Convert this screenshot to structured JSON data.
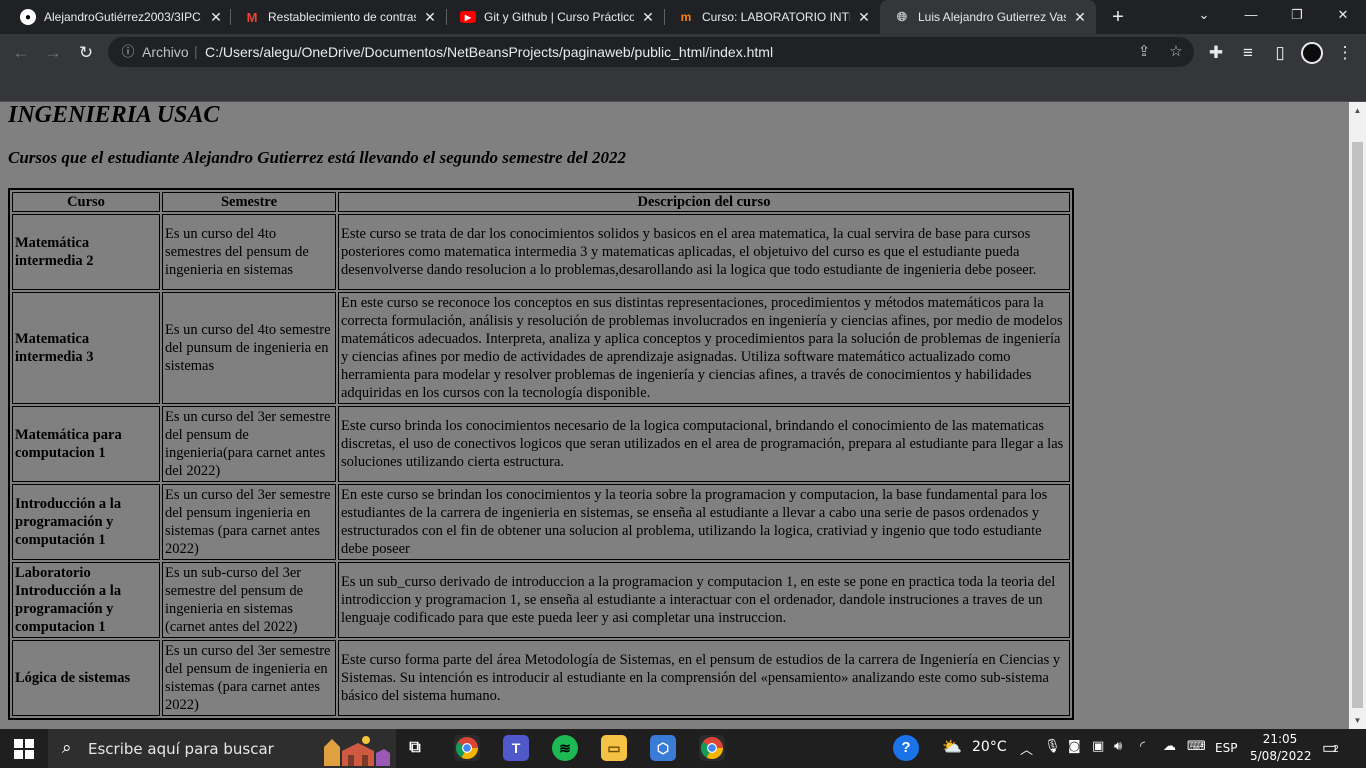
{
  "browser": {
    "tabs": [
      {
        "title": "AlejandroGutiérrez2003/3IPC",
        "favicon": "github-icon"
      },
      {
        "title": "Restablecimiento de contrase",
        "favicon": "gmail-icon"
      },
      {
        "title": "Git y Github | Curso Práctico",
        "favicon": "youtube-icon"
      },
      {
        "title": "Curso: LABORATORIO INTRO",
        "favicon": "moodle-icon"
      },
      {
        "title": "Luis Alejandro Gutierrez Vasc",
        "favicon": "globe-icon"
      }
    ],
    "active_tab_index": 4,
    "address": {
      "scheme_label": "Archivo",
      "url": "C:/Users/alegu/OneDrive/Documentos/NetBeansProjects/paginaweb/public_html/index.html"
    }
  },
  "page": {
    "title": "INGENIERIA USAC",
    "subtitle": "Cursos que el estudiante Alejandro Gutierrez está llevando el segundo semestre del 2022",
    "table": {
      "headers": [
        "Curso",
        "Semestre",
        "Descripcion del curso"
      ],
      "rows": [
        {
          "course": "Matemática intermedia 2",
          "semester": "Es un curso del 4to semestres del pensum de ingenieria en sistemas",
          "description": "Este curso se trata de dar los conocimientos solidos y basicos en el area matematica, la cual servira de base para cursos posteriores como matematica intermedia 3 y matematicas aplicadas, el objetuivo del curso es que el estudiante pueda desenvolverse dando resolucion a lo problemas,desarollando asi la logica que todo estudiante de ingenieria debe poseer."
        },
        {
          "course": "Matematica intermedia 3",
          "semester": "Es un curso del 4to semestre del punsum de ingenieria en sistemas",
          "description": "En este curso se reconoce los conceptos en sus distintas representaciones, procedimientos y métodos matemáticos para la correcta formulación, análisis y resolución de problemas involucrados en ingeniería y ciencias afines, por medio de modelos matemáticos adecuados. Interpreta, analiza y aplica conceptos y procedimientos para la solución de problemas de ingeniería y ciencias afines por medio de actividades de aprendizaje asignadas. Utiliza software matemático actualizado como herramienta para modelar y resolver problemas de ingeniería y ciencias afines, a través de conocimientos y habilidades adquiridas en los cursos con la tecnología disponible."
        },
        {
          "course": "Matemática para computacion 1",
          "semester": "Es un curso del 3er semestre del pensum de ingenieria(para carnet antes del 2022)",
          "description": "Este curso brinda los conocimientos necesario de la logica computacional, brindando el conocimiento de las matematicas discretas, el uso de conectivos logicos que seran utilizados en el area de programación, prepara al estudiante para llegar a las soluciones utilizando cierta estructura."
        },
        {
          "course": "Introducción a la programación y computación 1",
          "semester": "Es un curso del 3er semestre del pensum ingenieria en sistemas (para carnet antes 2022)",
          "description": "En este curso se brindan los conocimientos y la teoria sobre la programacion y computacion, la base fundamental para los estudiantes de la carrera de ingenieria en sistemas, se enseña al estudiante a llevar a cabo una serie de pasos ordenados y estructurados con el fin de obtener una solucion al problema, utilizando la logica, crativiad y ingenio que todo estudiante debe poseer"
        },
        {
          "course": "Laboratorio Introducción a la programación y computacion 1",
          "semester": "Es un sub-curso del 3er semestre del pensum de ingenieria en sistemas (carnet antes del 2022)",
          "description": "Es un sub_curso derivado de introduccion a la programacion y computacion 1, en este se pone en practica toda la teoria del introdiccion y programacion 1, se enseña al estudiante a interactuar con el ordenador, dandole instruciones a traves de un lenguaje codificado para que este pueda leer y asi completar una instruccion."
        },
        {
          "course": "Lógica de sistemas",
          "semester": "Es un curso del 3er semestre del pensum de ingenieria en sistemas (para carnet antes 2022)",
          "description": "Este curso forma parte del área Metodología de Sistemas, en el pensum de estudios de la carrera de Ingeniería en Ciencias y Sistemas. Su intención es introducir al estudiante en la comprensión del «pensamiento» analizando este como sub-sistema básico del sistema humano."
        }
      ]
    }
  },
  "taskbar": {
    "search_placeholder": "Escribe aquí para buscar",
    "weather": "20°C",
    "language": "ESP",
    "time": "21:05",
    "date": "5/08/2022",
    "notification_count": "2"
  },
  "colors": {
    "page_background": "#808080",
    "tabstrip": "#202124",
    "toolbar": "#35363a"
  }
}
